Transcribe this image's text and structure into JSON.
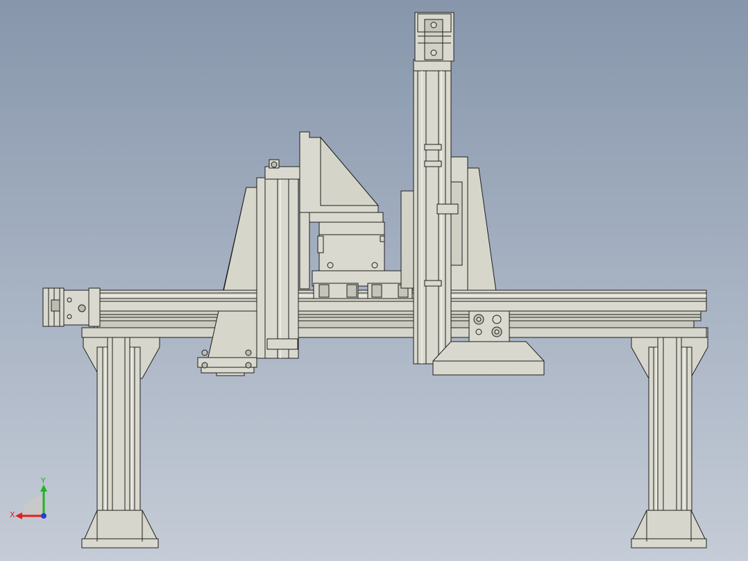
{
  "viewport": {
    "name": "cad-graphics-area",
    "colors": {
      "bg_top": "#8796ab",
      "bg_bottom": "#c5ccd7",
      "part_fill": "#d9d9cf",
      "part_fill_dark": "#c4c4b8",
      "edge": "#1e1e1e",
      "highlight": "#f2f2ec"
    }
  },
  "model": {
    "description_visible": false,
    "parts": [
      "gantry-beam",
      "left-leg",
      "right-leg",
      "z-axis-column",
      "x-motor",
      "z-motor",
      "carriage",
      "gripper-bracket"
    ]
  },
  "triad": {
    "x_label": "X",
    "y_label": "Y",
    "colors": {
      "x": "#e0201c",
      "y": "#1fb41f",
      "z": "#2a3cd8"
    }
  }
}
